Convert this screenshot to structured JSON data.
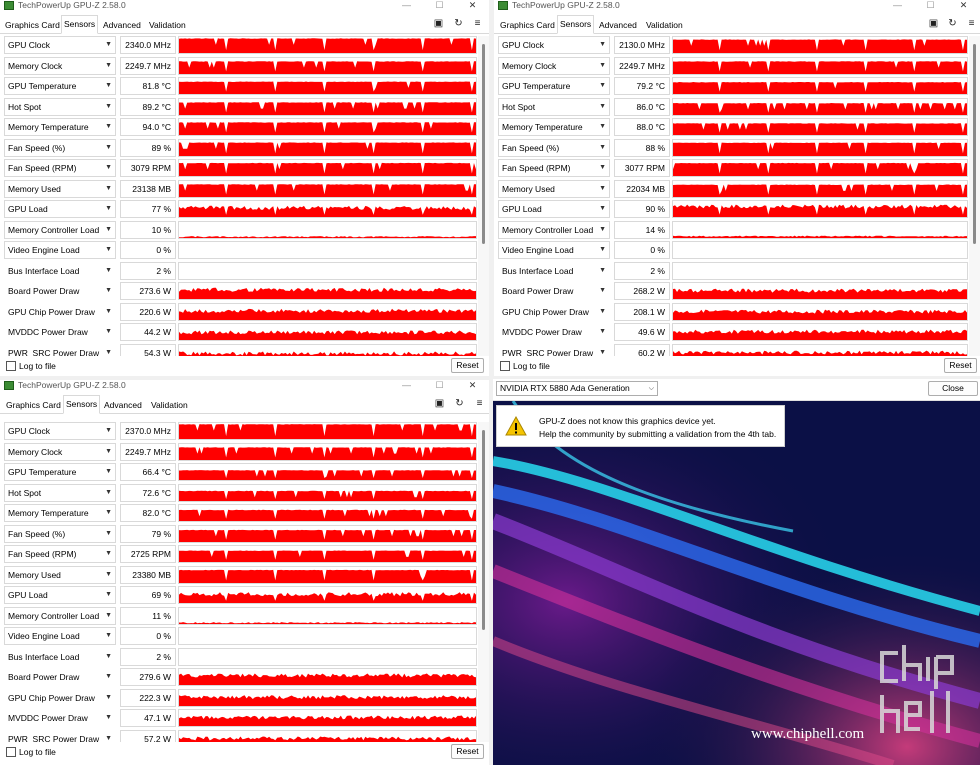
{
  "app_title": "TechPowerUp GPU-Z 2.58.0",
  "tabs": [
    "Graphics Card",
    "Sensors",
    "Advanced",
    "Validation"
  ],
  "active_tab": "Sensors",
  "log_to_file": "Log to file",
  "reset": "Reset",
  "sensor_names": [
    "GPU Clock",
    "Memory Clock",
    "GPU Temperature",
    "Hot Spot",
    "Memory Temperature",
    "Fan Speed (%)",
    "Fan Speed (RPM)",
    "Memory Used",
    "GPU Load",
    "Memory Controller Load",
    "Video Engine Load",
    "Bus Interface Load",
    "Board Power Draw",
    "GPU Chip Power Draw",
    "MVDDC Power Draw",
    "PWR_SRC Power Draw"
  ],
  "windows": {
    "top_left": {
      "values": [
        "2340.0 MHz",
        "2249.7 MHz",
        "81.8 °C",
        "89.2 °C",
        "94.0 °C",
        "89 %",
        "3079 RPM",
        "23138 MB",
        "77 %",
        "10 %",
        "0 %",
        "2 %",
        "273.6 W",
        "220.6 W",
        "44.2 W",
        "54.3 W"
      ]
    },
    "top_right": {
      "values": [
        "2130.0 MHz",
        "2249.7 MHz",
        "79.2 °C",
        "86.0 °C",
        "88.0 °C",
        "88 %",
        "3077 RPM",
        "22034 MB",
        "90 %",
        "14 %",
        "0 %",
        "2 %",
        "268.2 W",
        "208.1 W",
        "49.6 W",
        "60.2 W"
      ]
    },
    "bottom_left": {
      "values": [
        "2370.0 MHz",
        "2249.7 MHz",
        "66.4 °C",
        "72.6 °C",
        "82.0 °C",
        "79 %",
        "2725 RPM",
        "23380 MB",
        "69 %",
        "11 %",
        "0 %",
        "2 %",
        "279.6 W",
        "222.3 W",
        "47.1 W",
        "57.2 W"
      ]
    }
  },
  "sensor_levels": {
    "top_left": [
      0.92,
      0.8,
      0.78,
      0.8,
      0.8,
      0.85,
      0.82,
      0.8,
      0.7,
      0.12,
      0,
      0,
      0.7,
      0.7,
      0.6,
      0.6
    ],
    "top_right": [
      0.85,
      0.8,
      0.75,
      0.75,
      0.74,
      0.84,
      0.82,
      0.78,
      0.78,
      0.15,
      0,
      0,
      0.65,
      0.65,
      0.65,
      0.65
    ],
    "bottom_left": [
      0.93,
      0.8,
      0.62,
      0.64,
      0.7,
      0.76,
      0.72,
      0.82,
      0.68,
      0.12,
      0,
      0,
      0.72,
      0.68,
      0.66,
      0.66
    ]
  },
  "graph_color": "#ff0000",
  "device_name": "NVIDIA RTX 5880 Ada Generation",
  "close_label": "Close",
  "notice_line1": "GPU-Z does not know this graphics device yet.",
  "notice_line2": "Help the community by submitting a validation from the 4th tab.",
  "site_text": "www.chiphell.com",
  "logo_text": "chip hell"
}
